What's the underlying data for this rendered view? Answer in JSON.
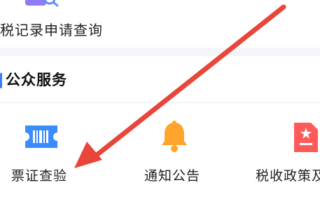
{
  "top_item": {
    "label": "税记录申请查询",
    "icon": "search-doc-icon"
  },
  "section": {
    "title": "公众服务"
  },
  "services": [
    {
      "label": "票证查验",
      "icon": "ticket-icon",
      "color": "#3b8cff"
    },
    {
      "label": "通知公告",
      "icon": "bell-icon",
      "color": "#ffa52e"
    },
    {
      "label": "税收政策及",
      "icon": "policy-doc-icon",
      "color": "#ff5a5a"
    }
  ],
  "colors": {
    "accent": "#3a7bff",
    "arrow": "#e8463a",
    "background_band": "#f3f5f9"
  }
}
